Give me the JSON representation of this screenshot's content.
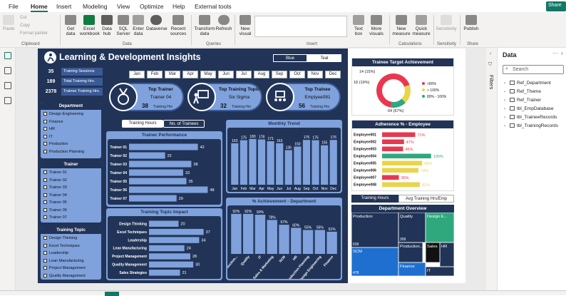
{
  "menu": {
    "tabs": [
      "File",
      "Home",
      "Insert",
      "Modeling",
      "View",
      "Optimize",
      "Help",
      "External tools"
    ],
    "active": "Home",
    "share": "Share"
  },
  "ribbon": {
    "clipboard": {
      "paste": "Paste",
      "cut": "Cut",
      "copy": "Copy",
      "format_painter": "Format painter",
      "group": "Clipboard"
    },
    "data": {
      "get_data": "Get data",
      "excel": "Excel workbook",
      "hub": "Data hub",
      "sql": "SQL Server",
      "enter": "Enter data",
      "dataverse": "Dataverse",
      "recent": "Recent sources",
      "group": "Data"
    },
    "queries": {
      "transform": "Transform data",
      "refresh": "Refresh",
      "group": "Queries"
    },
    "insert": {
      "new_visual": "New visual",
      "text_box": "Text box",
      "more_visuals": "More visuals",
      "group": "Insert"
    },
    "calculations": {
      "new_measure": "New measure",
      "quick_measure": "Quick measure",
      "group": "Calculations"
    },
    "sensitivity": {
      "label": "Sensitivity",
      "group": "Sensitivity"
    },
    "share": {
      "publish": "Publish",
      "group": "Share"
    }
  },
  "report": {
    "title": "Learning & Development Insights",
    "theme_buttons": [
      "Blue",
      "Teal"
    ],
    "kpis": [
      {
        "value": "35",
        "label": "Training Sessions"
      },
      {
        "value": "189",
        "label": "Total Training Hrs."
      },
      {
        "value": "2378",
        "label": "Trainee Training Hrs."
      }
    ],
    "months": [
      "Jan",
      "Feb",
      "Mar",
      "Apr",
      "May",
      "Jun",
      "Jul",
      "Aug",
      "Sep",
      "Oct",
      "Nov",
      "Dec"
    ],
    "top_cards": [
      {
        "title": "Top Trainer",
        "name": "Trainer 04",
        "value": "38",
        "unit": "Training Hrs"
      },
      {
        "title": "Top Training Topic",
        "name": "Six Sigma",
        "value": "32",
        "unit": "Training Hrs"
      },
      {
        "title": "Top Trainee",
        "name": "Emplyee081",
        "value": "56",
        "unit": "Training Hrs"
      }
    ],
    "toggle": [
      "Training Hours",
      "No. of Trainees"
    ],
    "slicers": {
      "department": {
        "title": "Department",
        "items": [
          "Design Engineering",
          "Finance",
          "HR",
          "IT",
          "Production",
          "Production Planning"
        ]
      },
      "trainer": {
        "title": "Trainer",
        "items": [
          "Trainer 01",
          "Trainer 02",
          "Trainer 03",
          "Trainer 04",
          "Trainer 05",
          "Trainer 06",
          "Trainer 07"
        ]
      },
      "topic": {
        "title": "Training Topic",
        "items": [
          "Design Thinking",
          "Excel Techniques",
          "Leadership",
          "Lean Manufacturing",
          "Project Management",
          "Quality Management"
        ]
      }
    }
  },
  "chart_data": [
    {
      "id": "trainer_performance",
      "type": "bar",
      "orientation": "horizontal",
      "title": "Trainer Performance",
      "categories": [
        "Trainer 01",
        "Trainer 02",
        "Trainer 03",
        "Trainer 04",
        "Trainer 05",
        "Trainer 06",
        "Trainer 07"
      ],
      "values": [
        42,
        22,
        38,
        33,
        35,
        48,
        29
      ]
    },
    {
      "id": "monthly_trend",
      "type": "bar",
      "title": "Monthly Trend",
      "categories": [
        "Jan",
        "Feb",
        "Mar",
        "Apr",
        "May",
        "Jun",
        "Jul",
        "Aug",
        "Sep",
        "Oct",
        "Nov",
        "Dec"
      ],
      "values": [
        163,
        175,
        180,
        178,
        171,
        163,
        136,
        150,
        176,
        175,
        155,
        176
      ]
    },
    {
      "id": "training_topic_impact",
      "type": "bar",
      "orientation": "horizontal",
      "title": "Training Topic Impact",
      "categories": [
        "Design Thinking",
        "Excel Techniques",
        "Leadership",
        "Lean Manufacturing",
        "Project Management",
        "Quality Management",
        "Sales Strategies"
      ],
      "values": [
        20,
        37,
        34,
        24,
        28,
        30,
        21
      ]
    },
    {
      "id": "achievement_department",
      "type": "bar",
      "title": "% Achievement - Department",
      "categories": [
        "Production...",
        "Quality",
        "IT",
        "Sales & Marketing",
        "SCM",
        "HR",
        "Production Planning",
        "Design Engineering",
        "Finance"
      ],
      "values": [
        92,
        92,
        90,
        78,
        67,
        60,
        55,
        55,
        51
      ],
      "labels": [
        "92%",
        "92%",
        "90%",
        "78%",
        "67%",
        "60%",
        "55%",
        "55%",
        "51%"
      ]
    },
    {
      "id": "trainee_target",
      "type": "pie",
      "style": "donut",
      "title": "Trainee Target Achievement",
      "slices": [
        {
          "label": "<80%",
          "value": 67,
          "text": "64 (67%)",
          "color": "#e8384f"
        },
        {
          "label": "> 100%",
          "value": 18,
          "text": "18 (19%)",
          "color": "#e9d44b"
        },
        {
          "label": "80% - 100%",
          "value": 15,
          "text": "14 (15%)",
          "color": "#2fa87e"
        }
      ]
    },
    {
      "id": "adherence_employee",
      "type": "bar",
      "orientation": "horizontal",
      "title": "Adherence % - Employee",
      "categories": [
        "Employee001",
        "Employee002",
        "Employee003",
        "Employee004",
        "Employee005",
        "Employee006",
        "Employee007",
        "Employee008"
      ],
      "values": [
        71,
        47,
        45,
        105,
        86,
        78,
        36,
        81
      ],
      "labels": [
        "71%",
        "47%",
        "45%",
        "105%",
        "86%",
        "78%",
        "36%",
        "81%"
      ],
      "colors": [
        "#e8384f",
        "#e8384f",
        "#e8384f",
        "#2fa87e",
        "#e9d44b",
        "#e9d44b",
        "#e8384f",
        "#e9d44b"
      ]
    },
    {
      "id": "department_overview",
      "type": "heatmap",
      "style": "treemap",
      "title": "Department Overview",
      "cells": [
        {
          "name": "Production",
          "value": "639"
        },
        {
          "name": "SCM",
          "value": "478"
        },
        {
          "name": "Quality",
          "value": "309"
        },
        {
          "name": "Production...",
          "value": ""
        },
        {
          "name": "Finance",
          "value": ""
        },
        {
          "name": "Design E...",
          "value": ""
        },
        {
          "name": "HR",
          "value": ""
        },
        {
          "name": "Sales",
          "value": ""
        },
        {
          "name": "IT",
          "value": ""
        }
      ]
    }
  ],
  "right_tabs": [
    "Training Hours",
    "Avg Training Hrs/Emp"
  ],
  "data_pane": {
    "title": "Data",
    "search_placeholder": "Search",
    "filters_label": "Filters",
    "tables": [
      "Ref_Department",
      "Ref_Theme",
      "Ref_Trainer",
      "tbl_EmpDatabase",
      "tbl_TraineeRecords",
      "tbl_TrainingRecords"
    ]
  },
  "colors": {
    "navy": "#213457",
    "mid": "#3a5a95",
    "light": "#7fa1dc",
    "bar": "#7fa1dc",
    "accent": "#117865"
  }
}
